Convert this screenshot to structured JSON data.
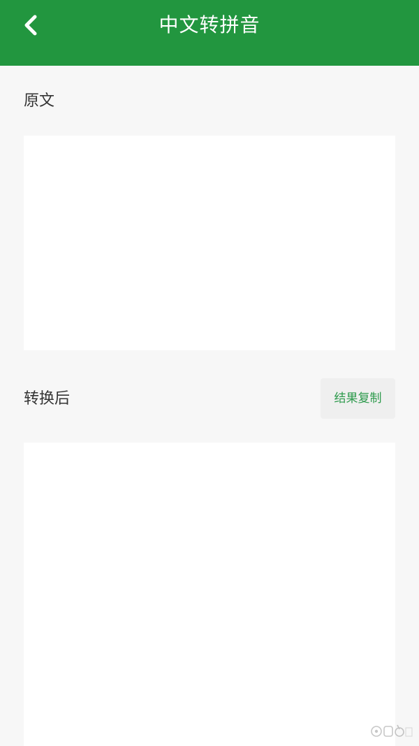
{
  "header": {
    "title": "中文转拼音",
    "back_icon": "chevron-left-icon",
    "background_color": "#22963f"
  },
  "source": {
    "label": "原文",
    "value": "",
    "placeholder": ""
  },
  "result": {
    "label": "转换后",
    "copy_label": "结果复制",
    "value": ""
  },
  "watermark": {
    "text": "pc6"
  },
  "colors": {
    "accent": "#22963f",
    "copy_text": "#2d9a4c",
    "page_background": "#f7f7f7"
  }
}
